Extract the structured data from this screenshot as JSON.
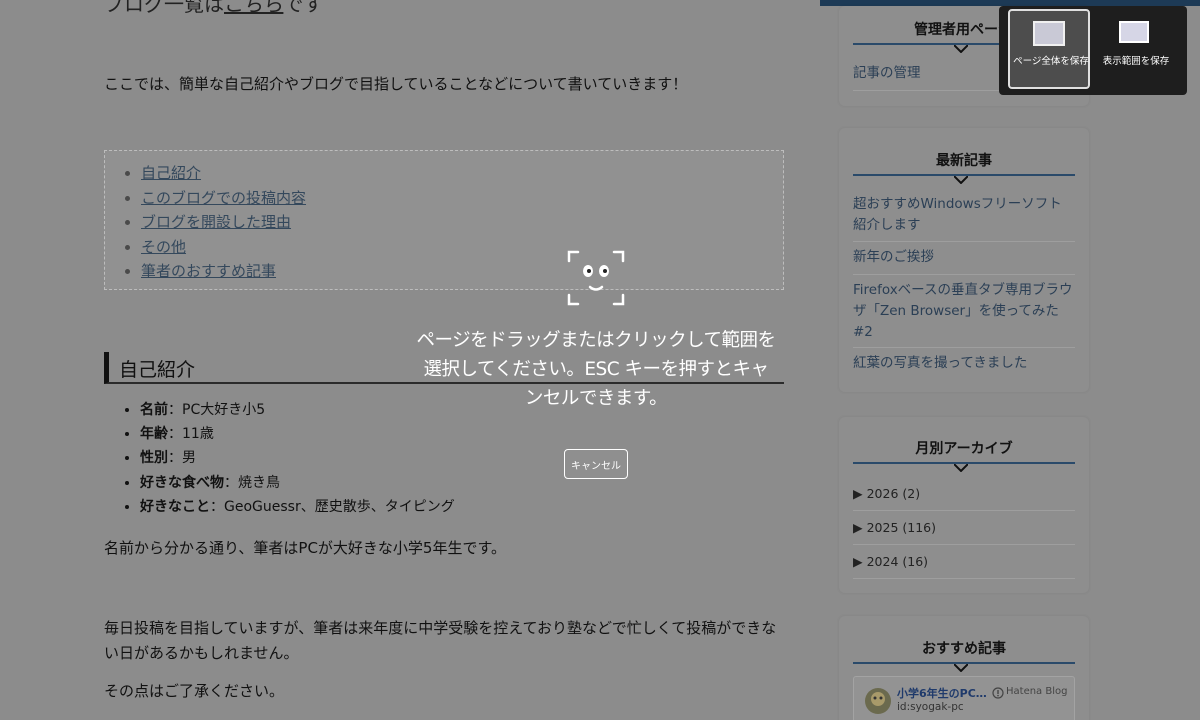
{
  "article": {
    "cut_title_prefix": "ブログ一覧は",
    "cut_title_link": "こちら",
    "cut_title_suffix": "です",
    "intro": "ここでは、簡単な自己紹介やブログで目指していることなどについて書いていきます！",
    "toc": [
      "自己紹介",
      "このブログでの投稿内容",
      "ブログを開設した理由",
      "その他",
      "筆者のおすすめ記事"
    ],
    "section_heading": "自己紹介",
    "profile": [
      {
        "key": "名前",
        "value": "：PC大好き小5"
      },
      {
        "key": "年齢",
        "value": "：11歳"
      },
      {
        "key": "性別",
        "value": "：男"
      },
      {
        "key": "好きな食べ物",
        "value": "：焼き鳥"
      },
      {
        "key": "好きなこと",
        "value": "：GeoGuessr、歴史散歩、タイピング"
      }
    ],
    "p1": "名前から分かる通り、筆者はPCが大好きな小学5年生です。",
    "p2": "毎日投稿を目指していますが、筆者は来年度に中学受験を控えており塾などで忙しくて投稿ができない日があるかもしれません。",
    "p3": "その点はご了承ください。"
  },
  "sidebar": {
    "admin": {
      "title": "管理者用ページ",
      "link": "記事の管理"
    },
    "recent": {
      "title": "最新記事",
      "items": [
        "超おすすめWindowsフリーソフト紹介します",
        "新年のご挨拶",
        "Firefoxベースの垂直タブ専用ブラウザ「Zen Browser」を使ってみた#2",
        "紅葉の写真を撮ってきました"
      ]
    },
    "archive": {
      "title": "月別アーカイブ",
      "items": [
        "▶ 2026 (2)",
        "▶ 2025 (116)",
        "▶ 2024 (16)"
      ]
    },
    "recommend": {
      "title": "おすすめ記事",
      "card_title": "小学6年生のPC…",
      "card_id": "id:syogak-pc",
      "card_source": "Hatena Blog"
    }
  },
  "overlay": {
    "instruction": "ページをドラッグまたはクリックして範囲を選択してください。ESC キーを押すとキャンセルできます。",
    "cancel": "キャンセル"
  },
  "toolbar": {
    "save_full": "ページ全体を保存",
    "save_visible": "表示範囲を保存"
  }
}
